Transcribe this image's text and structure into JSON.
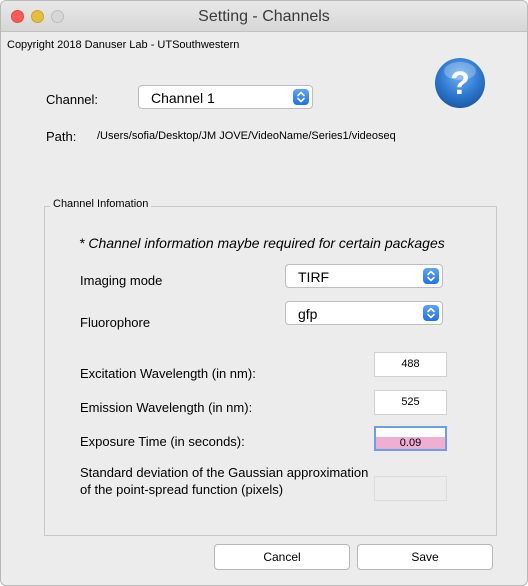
{
  "window": {
    "title": "Setting - Channels",
    "copyright": "Copyright 2018 Danuser Lab - UTSouthwestern"
  },
  "help": {
    "icon": "question-mark-icon",
    "glyph": "?",
    "color": "#2f7ad1"
  },
  "channel": {
    "label": "Channel:",
    "selected": "Channel 1"
  },
  "path": {
    "label": "Path:",
    "value": "/Users/sofia/Desktop/JM JOVE/VideoName/Series1/videoseq"
  },
  "channel_info": {
    "title": "Channel Infomation",
    "note": "* Channel information maybe required for certain packages",
    "imaging_mode": {
      "label": "Imaging mode",
      "selected": "TIRF"
    },
    "fluorophore": {
      "label": "Fluorophore",
      "selected": "gfp"
    },
    "excitation": {
      "label": "Excitation Wavelength (in nm):",
      "value": "488"
    },
    "emission": {
      "label": "Emission Wavelength (in nm):",
      "value": "525"
    },
    "exposure": {
      "label": "Exposure Time (in seconds):",
      "value": "0.09"
    },
    "psf": {
      "label": "Standard deviation of the Gaussian approximation of the point-spread function (pixels)",
      "value": ""
    }
  },
  "buttons": {
    "cancel": "Cancel",
    "save": "Save"
  },
  "colors": {
    "accent": "#1f73ea",
    "selection": "#f0aed0"
  }
}
